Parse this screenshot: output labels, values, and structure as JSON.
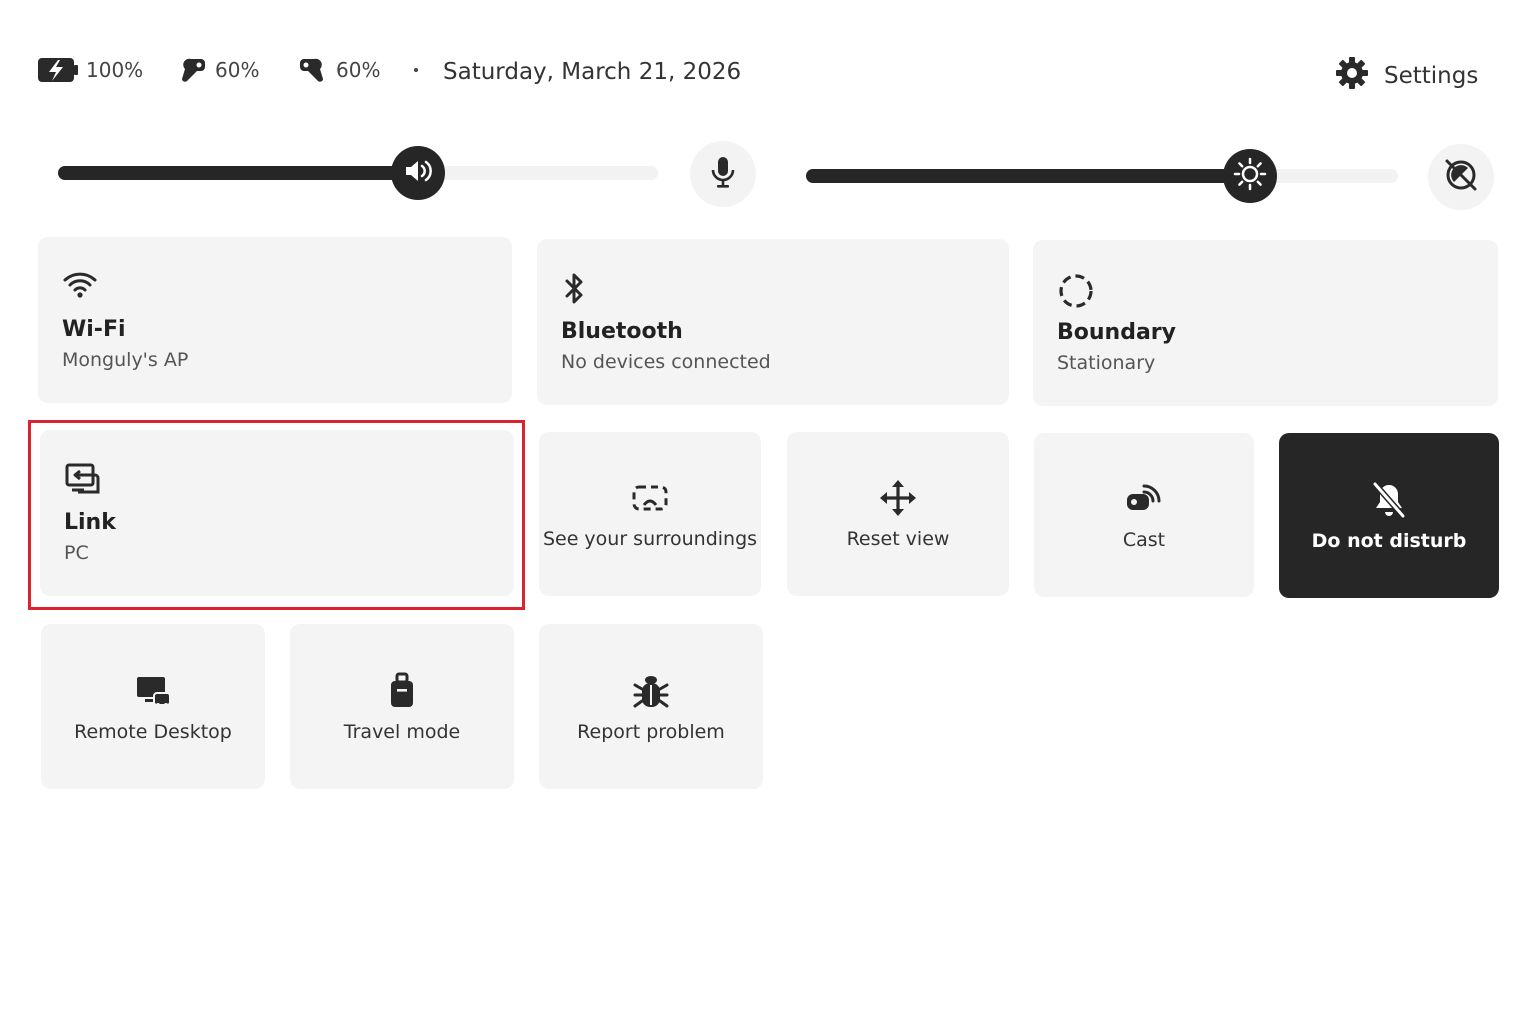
{
  "status": {
    "headset_battery": "100%",
    "left_controller_battery": "60%",
    "right_controller_battery": "60%",
    "date": "Saturday, March 21, 2026",
    "settings_label": "Settings"
  },
  "sliders": {
    "volume_level": 0.6,
    "brightness_level": 0.75
  },
  "tiles": {
    "wifi": {
      "title": "Wi-Fi",
      "subtitle": "Monguly's AP"
    },
    "bluetooth": {
      "title": "Bluetooth",
      "subtitle": "No devices connected"
    },
    "boundary": {
      "title": "Boundary",
      "subtitle": "Stationary"
    },
    "link": {
      "title": "Link",
      "subtitle": "PC"
    },
    "surroundings": {
      "label": "See your surroundings"
    },
    "reset_view": {
      "label": "Reset view"
    },
    "cast": {
      "label": "Cast"
    },
    "dnd": {
      "label": "Do not disturb"
    },
    "remote_desktop": {
      "label": "Remote Desktop"
    },
    "travel_mode": {
      "label": "Travel mode"
    },
    "report_problem": {
      "label": "Report problem"
    }
  },
  "icons": {
    "battery": "battery-charging-icon",
    "left_controller": "left-controller-icon",
    "right_controller": "right-controller-icon",
    "settings": "gear-icon",
    "volume": "volume-icon",
    "mic": "microphone-icon",
    "brightness": "sun-icon",
    "passthrough": "passthrough-off-icon",
    "wifi": "wifi-icon",
    "bluetooth": "bluetooth-icon",
    "boundary": "boundary-icon",
    "link": "link-icon",
    "surroundings": "surroundings-icon",
    "reset_view": "move-icon",
    "cast": "cast-icon",
    "dnd": "bell-off-icon",
    "remote_desktop": "remote-desktop-icon",
    "travel": "luggage-icon",
    "report": "bug-icon"
  },
  "colors": {
    "dark": "#262626",
    "tile_bg": "#f4f4f4",
    "highlight": "#d9232e"
  }
}
